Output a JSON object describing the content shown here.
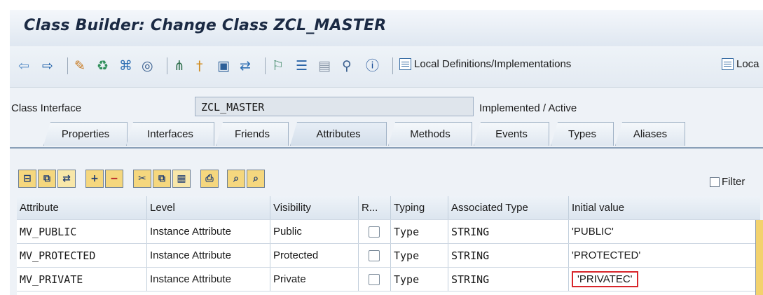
{
  "window": {
    "title": "Class Builder: Change Class ZCL_MASTER"
  },
  "toolbar": {
    "icons": [
      {
        "name": "back-icon",
        "glyph": "⇦"
      },
      {
        "name": "forward-icon",
        "glyph": "⇨"
      },
      {
        "name": "pencil-icon",
        "glyph": "✎"
      },
      {
        "name": "transport-icon",
        "glyph": "♻"
      },
      {
        "name": "object-tree-icon",
        "glyph": "⌘"
      },
      {
        "name": "where-used-icon",
        "glyph": "◎"
      },
      {
        "name": "hierarchy-icon",
        "glyph": "⋔"
      },
      {
        "name": "pin-icon",
        "glyph": "†"
      },
      {
        "name": "monitor-icon",
        "glyph": "▣"
      },
      {
        "name": "relations-icon",
        "glyph": "⇄"
      },
      {
        "name": "org-chart-icon",
        "glyph": "⚐"
      },
      {
        "name": "layout-icon",
        "glyph": "☰"
      },
      {
        "name": "panel-icon",
        "glyph": "▤"
      },
      {
        "name": "filter-icon",
        "glyph": "⚲"
      },
      {
        "name": "info-icon",
        "glyph": "ⓘ"
      }
    ],
    "local_definitions_label": "Local Definitions/Implementations",
    "local_types_label": "Loca"
  },
  "class_interface": {
    "label": "Class Interface",
    "value": "ZCL_MASTER",
    "status": "Implemented / Active"
  },
  "tabs": [
    {
      "name": "tab-properties",
      "label": "Properties"
    },
    {
      "name": "tab-interfaces",
      "label": "Interfaces"
    },
    {
      "name": "tab-friends",
      "label": "Friends"
    },
    {
      "name": "tab-attributes",
      "label": "Attributes",
      "active": true
    },
    {
      "name": "tab-methods",
      "label": "Methods"
    },
    {
      "name": "tab-events",
      "label": "Events"
    },
    {
      "name": "tab-types",
      "label": "Types"
    },
    {
      "name": "tab-aliases",
      "label": "Aliases"
    }
  ],
  "filter_label": "Filter",
  "table": {
    "columns": [
      "Attribute",
      "Level",
      "Visibility",
      "R...",
      "Typing",
      "Associated Type",
      "Initial value"
    ],
    "rows": [
      {
        "attribute": "MV_PUBLIC",
        "level": "Instance Attribute",
        "visibility": "Public",
        "readonly": false,
        "typing": "Type",
        "associated_type": "STRING",
        "initial_value": "'PUBLIC'"
      },
      {
        "attribute": "MV_PROTECTED",
        "level": "Instance Attribute",
        "visibility": "Protected",
        "readonly": false,
        "typing": "Type",
        "associated_type": "STRING",
        "initial_value": "'PROTECTED'"
      },
      {
        "attribute": "MV_PRIVATE",
        "level": "Instance Attribute",
        "visibility": "Private",
        "readonly": false,
        "typing": "Type",
        "associated_type": "STRING",
        "initial_value": "'PRIVATEC'"
      }
    ]
  },
  "colors": {
    "title_bg": "#dfe7f1",
    "panel_bg": "#eef2f7",
    "highlight": "#d8262b",
    "toolbar_button": "#f5d77e"
  }
}
